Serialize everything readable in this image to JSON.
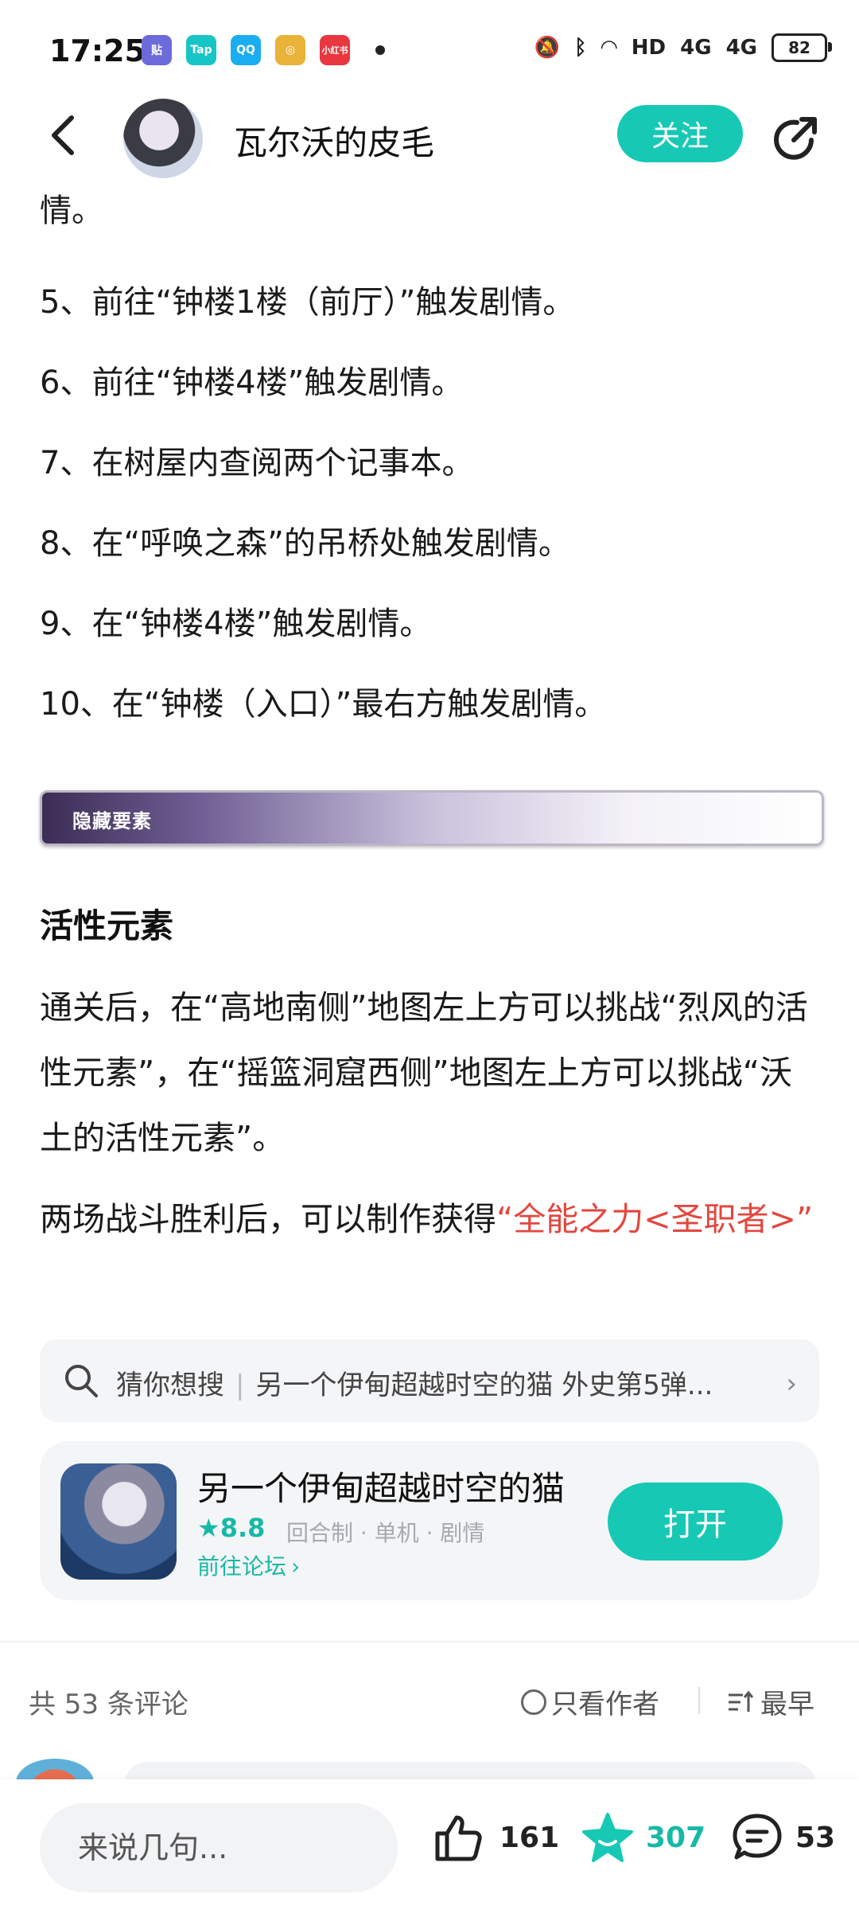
{
  "status_bar": {
    "time": "17:25",
    "app_icons": [
      {
        "name": "tieba-icon",
        "label": "贴",
        "color": "#6d6ad9"
      },
      {
        "name": "taptap-icon",
        "label": "Tap",
        "color": "#17c5c7"
      },
      {
        "name": "qq-icon",
        "label": "QQ",
        "color": "#1aaef0"
      },
      {
        "name": "app-icon",
        "label": "◎",
        "color": "#e9b33a"
      },
      {
        "name": "xiaohongshu-icon",
        "label": "小红书",
        "color": "#e8373f"
      }
    ],
    "signal_label": "HD",
    "network_1": "4G",
    "network_2": "4G",
    "battery": "82"
  },
  "header": {
    "author_name": "瓦尔沃的皮毛",
    "follow_label": "关注"
  },
  "article": {
    "lines": [
      "情。",
      "5、前往“钟楼1楼（前厅）”触发剧情。",
      "6、前往“钟楼4楼”触发剧情。",
      "7、在树屋内查阅两个记事本。",
      "8、在“呼唤之森”的吊桥处触发剧情。",
      "9、在“钟楼4楼”触发剧情。",
      "10、在“钟楼（入口）”最右方触发剧情。"
    ],
    "banner_label": "隐藏要素",
    "section_title": "活性元素",
    "section_para_1": "通关后，在“高地南侧”地图左上方可以挑战“烈风的活性元素”，在“摇篮洞窟西侧”地图左上方可以挑战“沃土的活性元素”。",
    "section_para_2_prefix": "两场战斗胜利后，可以制作获得",
    "section_para_2_highlight": "“全能之力<圣职者>”"
  },
  "search_suggest": {
    "prefix": "猜你想搜",
    "text": "另一个伊甸超越时空的猫 外史第5弹..."
  },
  "game_card": {
    "title": "另一个伊甸超越时空的猫",
    "rating": "★8.8",
    "tags": "回合制 · 单机 · 剧情",
    "forum_link": "前往论坛",
    "open_label": "打开"
  },
  "comments_bar": {
    "count_text": "共 53 条评论",
    "only_author": "只看作者",
    "sort_label": "最早"
  },
  "bottom_bar": {
    "input_placeholder": "来说几句...",
    "likes": "161",
    "favorites": "307",
    "comments": "53"
  }
}
